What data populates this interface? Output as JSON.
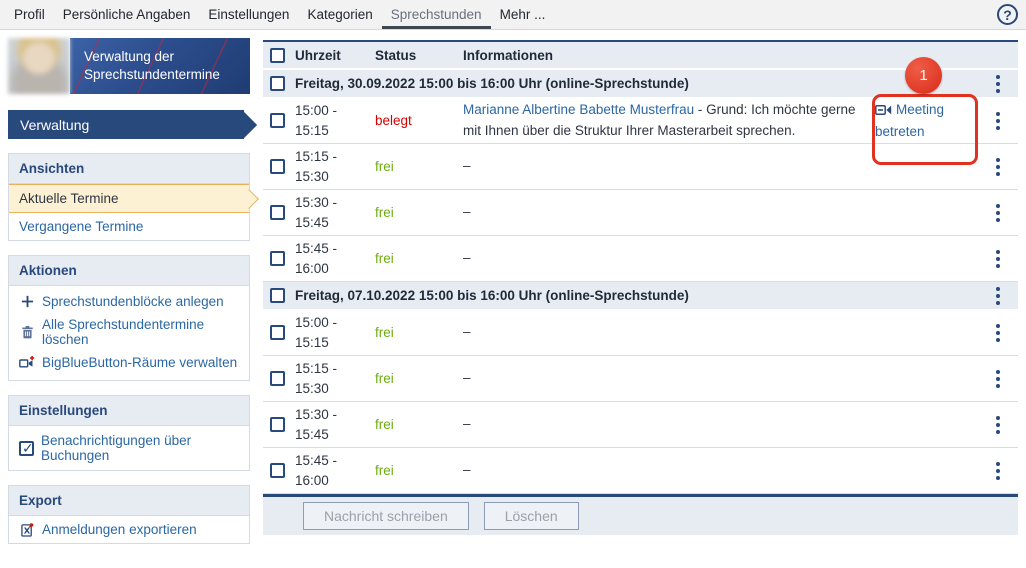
{
  "colors": {
    "navy": "#28497c",
    "link": "#2b67a4",
    "free": "#6ead10",
    "busy": "#d60000",
    "headbg": "#e7ebf2",
    "hl-bg": "#fdf1d4",
    "hl-border": "#e8b15d",
    "ann": "#e0321f"
  },
  "topnav": {
    "items": [
      {
        "label": "Profil"
      },
      {
        "label": "Persönliche Angaben"
      },
      {
        "label": "Einstellungen"
      },
      {
        "label": "Kategorien"
      },
      {
        "label": "Sprechstunden"
      },
      {
        "label": "Mehr ..."
      }
    ],
    "help_label": "?"
  },
  "sidebar": {
    "title": "Verwaltung der Sprechstundentermine",
    "context": "Verwaltung",
    "views": {
      "title": "Ansichten",
      "items": [
        {
          "label": "Aktuelle Termine"
        },
        {
          "label": "Vergangene Termine"
        }
      ]
    },
    "actions": {
      "title": "Aktionen",
      "items": [
        {
          "icon": "plus-icon",
          "label": "Sprechstundenblöcke anlegen"
        },
        {
          "icon": "trash-icon",
          "label": "Alle Sprechstundentermine löschen"
        },
        {
          "icon": "video-plus-icon",
          "label": "BigBlueButton-Räume verwalten"
        }
      ]
    },
    "settings": {
      "title": "Einstellungen",
      "checkbox_label": "Benachrichtigungen über Buchungen",
      "checked": true
    },
    "export": {
      "title": "Export",
      "item_label": "Anmeldungen exportieren"
    }
  },
  "table": {
    "columns": {
      "time": "Uhrzeit",
      "status": "Status",
      "info": "Informationen"
    },
    "empty_info": "–",
    "groups": [
      {
        "date_label": "Freitag, 30.09.2022 15:00 bis 16:00 Uhr (online-Sprechstunde)",
        "rows": [
          {
            "time_from": "15:00 -",
            "time_to": "15:15",
            "status": "belegt",
            "info_link": "Marianne Albertine Babette Musterfrau",
            "info_rest": " - Grund: Ich möchte gerne mit Ihnen über die Struktur Ihrer Masterarbeit sprechen.",
            "action_label": "Meeting betreten"
          },
          {
            "time_from": "15:15 -",
            "time_to": "15:30",
            "status": "frei",
            "info": "–"
          },
          {
            "time_from": "15:30 -",
            "time_to": "15:45",
            "status": "frei",
            "info": "–"
          },
          {
            "time_from": "15:45 -",
            "time_to": "16:00",
            "status": "frei",
            "info": "–"
          }
        ]
      },
      {
        "date_label": "Freitag, 07.10.2022 15:00 bis 16:00 Uhr (online-Sprechstunde)",
        "rows": [
          {
            "time_from": "15:00 -",
            "time_to": "15:15",
            "status": "frei",
            "info": "–"
          },
          {
            "time_from": "15:15 -",
            "time_to": "15:30",
            "status": "frei",
            "info": "–"
          },
          {
            "time_from": "15:30 -",
            "time_to": "15:45",
            "status": "frei",
            "info": "–"
          },
          {
            "time_from": "15:45 -",
            "time_to": "16:00",
            "status": "frei",
            "info": "–"
          }
        ]
      }
    ]
  },
  "footer": {
    "message_button": "Nachricht schreiben",
    "delete_button": "Löschen"
  },
  "annotation": {
    "badge": "1"
  }
}
